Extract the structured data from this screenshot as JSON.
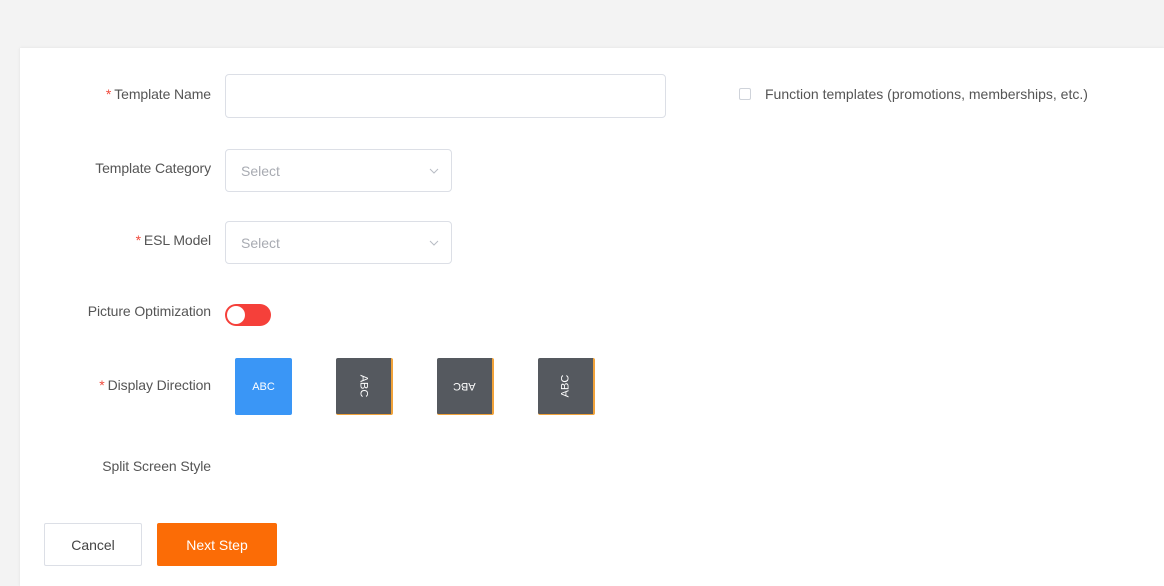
{
  "form": {
    "required_mark": "*",
    "template_name": {
      "label": "Template Name",
      "value": ""
    },
    "function_templates": {
      "label": "Function templates (promotions, memberships, etc.)",
      "checked": false
    },
    "template_category": {
      "label": "Template Category",
      "placeholder": "Select"
    },
    "esl_model": {
      "label": "ESL Model",
      "placeholder": "Select"
    },
    "picture_optimization": {
      "label": "Picture Optimization",
      "enabled": false
    },
    "display_direction": {
      "label": "Display Direction",
      "options": [
        {
          "text": "ABC",
          "rotation_deg": 0,
          "selected": true
        },
        {
          "text": "ABC",
          "rotation_deg": 90,
          "selected": false
        },
        {
          "text": "ABC",
          "rotation_deg": 180,
          "selected": false
        },
        {
          "text": "ABC",
          "rotation_deg": 270,
          "selected": false
        }
      ]
    },
    "split_screen_style": {
      "label": "Split Screen Style"
    }
  },
  "actions": {
    "cancel_label": "Cancel",
    "next_label": "Next Step"
  },
  "colors": {
    "accent_blue": "#3a96f6",
    "primary_orange": "#fb6c06",
    "toggle_red": "#f5403a",
    "required_red": "#f04b3d",
    "inactive_tile": "#55595f"
  }
}
